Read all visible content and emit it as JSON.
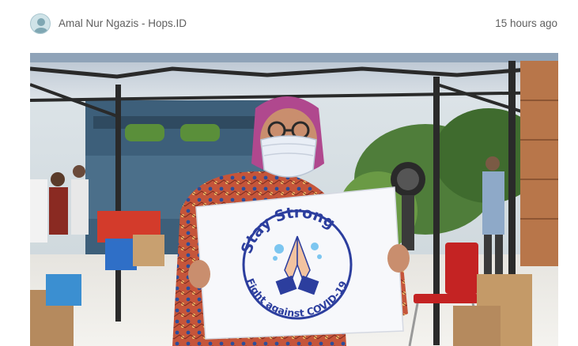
{
  "post": {
    "author": "Amal Nur Ngazis - Hops.ID",
    "timestamp": "15 hours ago"
  },
  "photo": {
    "sign_top_text": "Stay Strong",
    "sign_bottom_text": "Fight against COVID-19"
  },
  "icons": {
    "avatar": "user-avatar-icon"
  },
  "colors": {
    "sign_blue": "#2c3e9e",
    "tent_frame": "#2a2a2a",
    "hijab": "#b0488e",
    "batik": "#c5553a"
  }
}
